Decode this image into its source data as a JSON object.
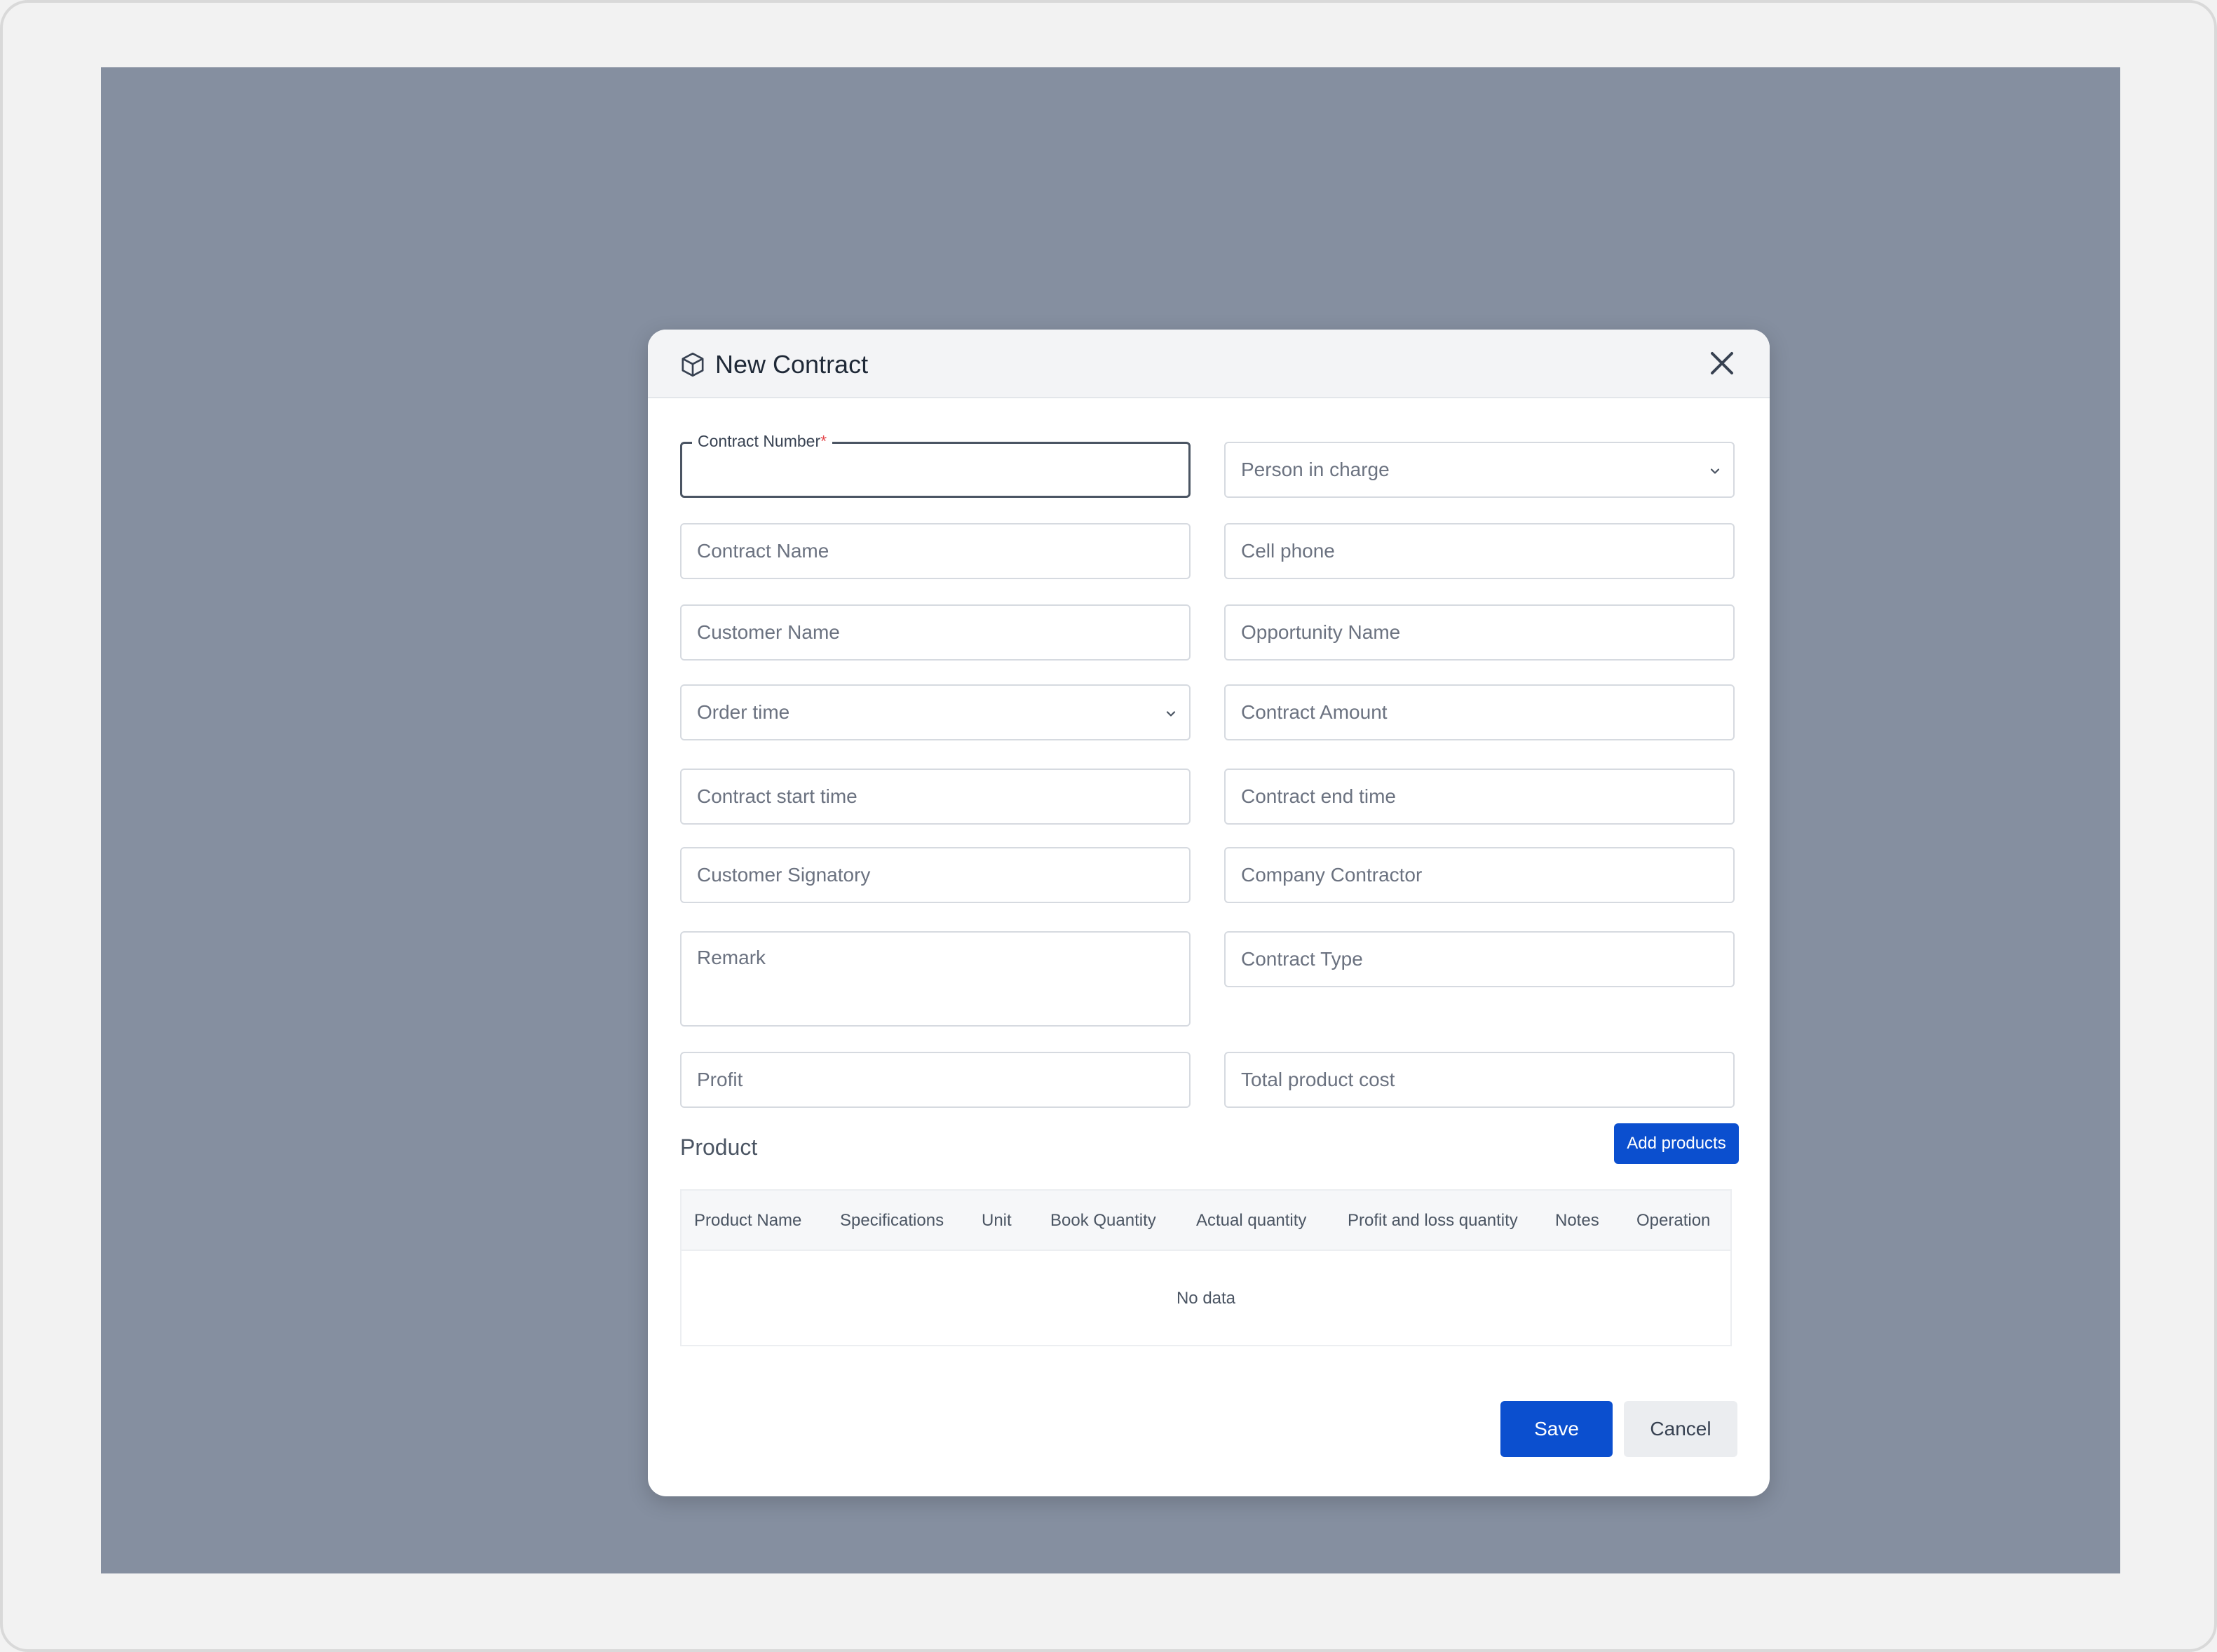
{
  "dialog": {
    "title": "New Contract",
    "icon": "cube-icon",
    "close_icon": "close-icon"
  },
  "form": {
    "contract_number": {
      "label": "Contract Number",
      "required_mark": "*",
      "value": ""
    },
    "person_in_charge": {
      "placeholder": "Person in charge",
      "type": "select"
    },
    "contract_name": {
      "placeholder": "Contract Name"
    },
    "cell_phone": {
      "placeholder": "Cell phone"
    },
    "customer_name": {
      "placeholder": "Customer Name"
    },
    "opportunity_name": {
      "placeholder": "Opportunity Name"
    },
    "order_time": {
      "placeholder": "Order time",
      "type": "select"
    },
    "contract_amount": {
      "placeholder": "Contract Amount"
    },
    "contract_start_time": {
      "placeholder": "Contract start time"
    },
    "contract_end_time": {
      "placeholder": "Contract end time"
    },
    "customer_signatory": {
      "placeholder": "Customer Signatory"
    },
    "company_contractor": {
      "placeholder": "Company Contractor"
    },
    "remark": {
      "placeholder": "Remark"
    },
    "contract_type": {
      "placeholder": "Contract Type"
    },
    "profit": {
      "placeholder": "Profit"
    },
    "total_product_cost": {
      "placeholder": "Total product cost"
    }
  },
  "product": {
    "section_title": "Product",
    "add_button": "Add products",
    "columns": [
      "Product Name",
      "Specifications",
      "Unit",
      "Book Quantity",
      "Actual quantity",
      "Profit and loss quantity",
      "Notes",
      "Operation"
    ],
    "empty_text": "No data"
  },
  "footer": {
    "save_label": "Save",
    "cancel_label": "Cancel"
  },
  "colors": {
    "primary": "#0b4fcf",
    "overlay": "#858fa0",
    "required": "#e5484d"
  }
}
